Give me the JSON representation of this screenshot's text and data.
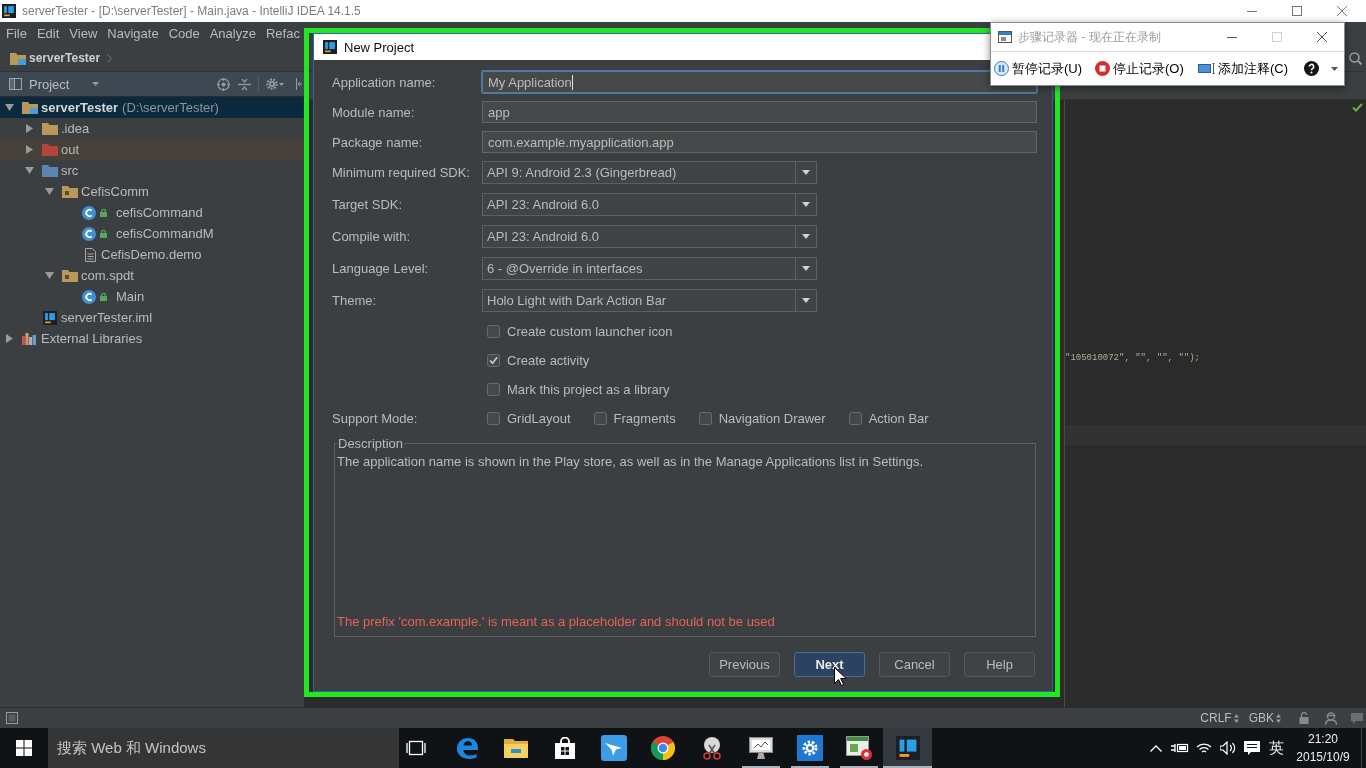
{
  "ide": {
    "title": "serverTester - [D:\\serverTester] - Main.java - IntelliJ IDEA 14.1.5",
    "menu": [
      "File",
      "Edit",
      "View",
      "Navigate",
      "Code",
      "Analyze",
      "Refac"
    ],
    "breadcrumb": "serverTester",
    "project_panel": {
      "view": "Project",
      "tree": [
        {
          "kind": "module",
          "label": "serverTester",
          "detail": "(D:\\serverTester)",
          "expanded": true,
          "selected": true,
          "children": [
            {
              "kind": "folder",
              "label": ".idea",
              "expanded": false,
              "selected": false
            },
            {
              "kind": "excluded-folder",
              "label": "out",
              "expanded": false,
              "selected": false
            },
            {
              "kind": "source-folder",
              "label": "src",
              "expanded": true,
              "selected": false,
              "children": [
                {
                  "kind": "package",
                  "label": "CefisComm",
                  "expanded": true,
                  "selected": false,
                  "children": [
                    {
                      "kind": "class",
                      "label": "cefisCommand",
                      "selected": false
                    },
                    {
                      "kind": "class",
                      "label": "cefisCommandM",
                      "selected": false
                    },
                    {
                      "kind": "file",
                      "label": "CefisDemo.demo",
                      "selected": false
                    }
                  ]
                },
                {
                  "kind": "package",
                  "label": "com.spdt",
                  "expanded": true,
                  "selected": false,
                  "children": [
                    {
                      "kind": "class",
                      "label": "Main",
                      "selected": false
                    }
                  ]
                }
              ]
            },
            {
              "kind": "module-file",
              "label": "serverTester.iml",
              "selected": false
            }
          ]
        },
        {
          "kind": "libraries",
          "label": "External Libraries",
          "expanded": false,
          "selected": false
        }
      ]
    },
    "editor": {
      "code": "\"105010072\", \"\", \"\", \"\");"
    },
    "status_bar": {
      "line_separator": "CRLF",
      "encoding": "GBK"
    }
  },
  "dialog": {
    "title": "New Project",
    "fields": [
      {
        "kind": "text",
        "label": "Application name:",
        "value": "My Application",
        "focused": true
      },
      {
        "kind": "text",
        "label": "Module name:",
        "value": "app",
        "focused": false
      },
      {
        "kind": "text",
        "label": "Package name:",
        "value": "com.example.myapplication.app",
        "focused": false
      },
      {
        "kind": "combo",
        "label": "Minimum required SDK:",
        "value": "API 9: Android 2.3 (Gingerbread)",
        "focused": false
      },
      {
        "kind": "combo",
        "label": "Target SDK:",
        "value": "API 23: Android 6.0",
        "focused": false
      },
      {
        "kind": "combo",
        "label": "Compile with:",
        "value": "API 23: Android 6.0",
        "focused": false
      },
      {
        "kind": "combo",
        "label": "Language Level:",
        "value": "6 - @Override in interfaces",
        "focused": false
      },
      {
        "kind": "combo",
        "label": "Theme:",
        "value": "Holo Light with Dark Action Bar",
        "focused": false
      }
    ],
    "options": [
      {
        "label": "Create custom launcher icon",
        "checked": false
      },
      {
        "label": "Create activity",
        "checked": true
      },
      {
        "label": "Mark this project as a library",
        "checked": false
      }
    ],
    "support_mode": {
      "label": "Support Mode:",
      "options": [
        {
          "label": "GridLayout",
          "checked": false
        },
        {
          "label": "Fragments",
          "checked": false
        },
        {
          "label": "Navigation Drawer",
          "checked": false
        },
        {
          "label": "Action Bar",
          "checked": false
        }
      ]
    },
    "description": {
      "title": "Description",
      "text": "The application name is shown in the Play store, as well as in the Manage Applications list in Settings.",
      "warning": "The prefix 'com.example.' is meant as a placeholder and should not be used"
    },
    "buttons": [
      {
        "label": "Previous",
        "default": false
      },
      {
        "label": "Next",
        "default": true
      },
      {
        "label": "Cancel",
        "default": false
      },
      {
        "label": "Help",
        "default": false
      }
    ]
  },
  "recorder": {
    "title": "步骤记录器 - 现在正在录制",
    "buttons": [
      {
        "kind": "pause",
        "label": "暂停记录(U)"
      },
      {
        "kind": "stop",
        "label": "停止记录(O)"
      },
      {
        "kind": "comment",
        "label": "添加注释(C)"
      },
      {
        "kind": "help"
      }
    ]
  },
  "taskbar": {
    "search": {
      "placeholder": "搜索 Web 和 Windows"
    },
    "apps": [
      {
        "kind": "edge",
        "running": false,
        "selected": false
      },
      {
        "kind": "explorer",
        "running": false,
        "selected": false
      },
      {
        "kind": "store",
        "running": false,
        "selected": false
      },
      {
        "kind": "bird",
        "running": false,
        "selected": false
      },
      {
        "kind": "chrome",
        "running": false,
        "selected": false
      },
      {
        "kind": "scissors",
        "running": false,
        "selected": false
      },
      {
        "kind": "monitor",
        "running": true,
        "selected": false
      },
      {
        "kind": "gear",
        "running": true,
        "selected": false
      },
      {
        "kind": "recorder",
        "running": true,
        "selected": false
      },
      {
        "kind": "intellij",
        "running": true,
        "selected": true
      }
    ],
    "tray": {
      "input_method": "英",
      "time": "21:20",
      "date": "2015/10/9"
    }
  }
}
